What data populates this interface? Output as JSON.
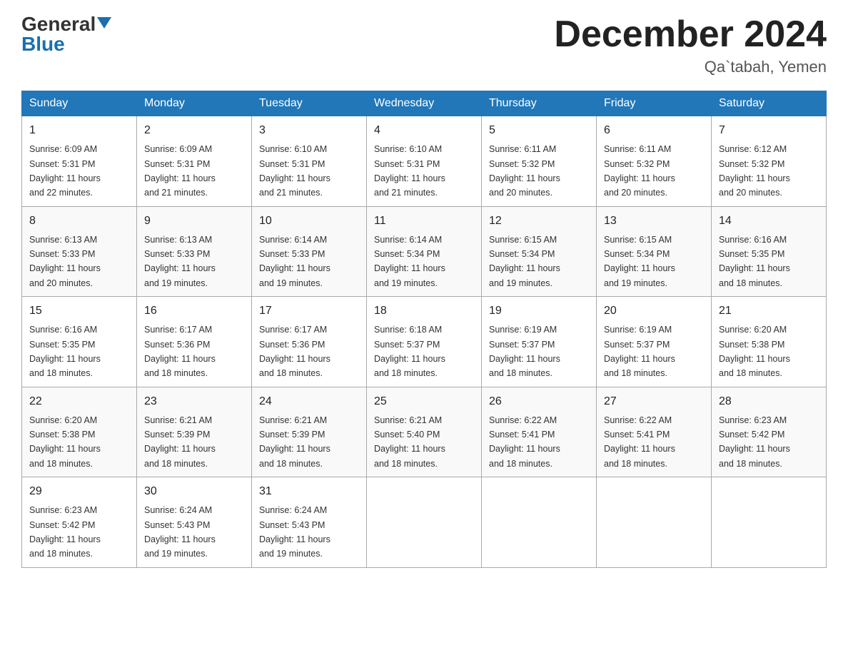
{
  "header": {
    "logo_general": "General",
    "logo_blue": "Blue",
    "month_title": "December 2024",
    "location": "Qa`tabah, Yemen"
  },
  "days_of_week": [
    "Sunday",
    "Monday",
    "Tuesday",
    "Wednesday",
    "Thursday",
    "Friday",
    "Saturday"
  ],
  "weeks": [
    [
      {
        "day": "1",
        "sunrise": "6:09 AM",
        "sunset": "5:31 PM",
        "daylight": "11 hours and 22 minutes."
      },
      {
        "day": "2",
        "sunrise": "6:09 AM",
        "sunset": "5:31 PM",
        "daylight": "11 hours and 21 minutes."
      },
      {
        "day": "3",
        "sunrise": "6:10 AM",
        "sunset": "5:31 PM",
        "daylight": "11 hours and 21 minutes."
      },
      {
        "day": "4",
        "sunrise": "6:10 AM",
        "sunset": "5:31 PM",
        "daylight": "11 hours and 21 minutes."
      },
      {
        "day": "5",
        "sunrise": "6:11 AM",
        "sunset": "5:32 PM",
        "daylight": "11 hours and 20 minutes."
      },
      {
        "day": "6",
        "sunrise": "6:11 AM",
        "sunset": "5:32 PM",
        "daylight": "11 hours and 20 minutes."
      },
      {
        "day": "7",
        "sunrise": "6:12 AM",
        "sunset": "5:32 PM",
        "daylight": "11 hours and 20 minutes."
      }
    ],
    [
      {
        "day": "8",
        "sunrise": "6:13 AM",
        "sunset": "5:33 PM",
        "daylight": "11 hours and 20 minutes."
      },
      {
        "day": "9",
        "sunrise": "6:13 AM",
        "sunset": "5:33 PM",
        "daylight": "11 hours and 19 minutes."
      },
      {
        "day": "10",
        "sunrise": "6:14 AM",
        "sunset": "5:33 PM",
        "daylight": "11 hours and 19 minutes."
      },
      {
        "day": "11",
        "sunrise": "6:14 AM",
        "sunset": "5:34 PM",
        "daylight": "11 hours and 19 minutes."
      },
      {
        "day": "12",
        "sunrise": "6:15 AM",
        "sunset": "5:34 PM",
        "daylight": "11 hours and 19 minutes."
      },
      {
        "day": "13",
        "sunrise": "6:15 AM",
        "sunset": "5:34 PM",
        "daylight": "11 hours and 19 minutes."
      },
      {
        "day": "14",
        "sunrise": "6:16 AM",
        "sunset": "5:35 PM",
        "daylight": "11 hours and 18 minutes."
      }
    ],
    [
      {
        "day": "15",
        "sunrise": "6:16 AM",
        "sunset": "5:35 PM",
        "daylight": "11 hours and 18 minutes."
      },
      {
        "day": "16",
        "sunrise": "6:17 AM",
        "sunset": "5:36 PM",
        "daylight": "11 hours and 18 minutes."
      },
      {
        "day": "17",
        "sunrise": "6:17 AM",
        "sunset": "5:36 PM",
        "daylight": "11 hours and 18 minutes."
      },
      {
        "day": "18",
        "sunrise": "6:18 AM",
        "sunset": "5:37 PM",
        "daylight": "11 hours and 18 minutes."
      },
      {
        "day": "19",
        "sunrise": "6:19 AM",
        "sunset": "5:37 PM",
        "daylight": "11 hours and 18 minutes."
      },
      {
        "day": "20",
        "sunrise": "6:19 AM",
        "sunset": "5:37 PM",
        "daylight": "11 hours and 18 minutes."
      },
      {
        "day": "21",
        "sunrise": "6:20 AM",
        "sunset": "5:38 PM",
        "daylight": "11 hours and 18 minutes."
      }
    ],
    [
      {
        "day": "22",
        "sunrise": "6:20 AM",
        "sunset": "5:38 PM",
        "daylight": "11 hours and 18 minutes."
      },
      {
        "day": "23",
        "sunrise": "6:21 AM",
        "sunset": "5:39 PM",
        "daylight": "11 hours and 18 minutes."
      },
      {
        "day": "24",
        "sunrise": "6:21 AM",
        "sunset": "5:39 PM",
        "daylight": "11 hours and 18 minutes."
      },
      {
        "day": "25",
        "sunrise": "6:21 AM",
        "sunset": "5:40 PM",
        "daylight": "11 hours and 18 minutes."
      },
      {
        "day": "26",
        "sunrise": "6:22 AM",
        "sunset": "5:41 PM",
        "daylight": "11 hours and 18 minutes."
      },
      {
        "day": "27",
        "sunrise": "6:22 AM",
        "sunset": "5:41 PM",
        "daylight": "11 hours and 18 minutes."
      },
      {
        "day": "28",
        "sunrise": "6:23 AM",
        "sunset": "5:42 PM",
        "daylight": "11 hours and 18 minutes."
      }
    ],
    [
      {
        "day": "29",
        "sunrise": "6:23 AM",
        "sunset": "5:42 PM",
        "daylight": "11 hours and 18 minutes."
      },
      {
        "day": "30",
        "sunrise": "6:24 AM",
        "sunset": "5:43 PM",
        "daylight": "11 hours and 19 minutes."
      },
      {
        "day": "31",
        "sunrise": "6:24 AM",
        "sunset": "5:43 PM",
        "daylight": "11 hours and 19 minutes."
      },
      null,
      null,
      null,
      null
    ]
  ],
  "labels": {
    "sunrise": "Sunrise:",
    "sunset": "Sunset:",
    "daylight": "Daylight:"
  }
}
